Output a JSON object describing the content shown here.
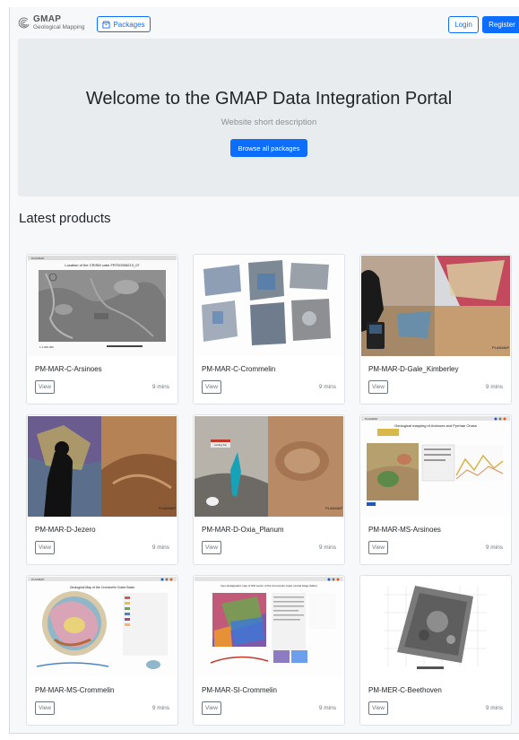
{
  "brand": {
    "title": "GMAP",
    "subtitle": "Geological Mapping"
  },
  "nav": {
    "packages_label": "Packages",
    "login_label": "Login",
    "register_label": "Register"
  },
  "hero": {
    "title": "Welcome to the GMAP Data Integration Portal",
    "subtitle": "Website short description",
    "button_label": "Browse all packages"
  },
  "section": {
    "title": "Latest products"
  },
  "products": [
    {
      "name": "PM-MAR-C-Arsinoes",
      "view_label": "View",
      "time": "9 mins"
    },
    {
      "name": "PM-MAR-C-Crommelin",
      "view_label": "View",
      "time": "9 mins"
    },
    {
      "name": "PM-MAR-D-Gale_Kimberley",
      "view_label": "View",
      "time": "9 mins"
    },
    {
      "name": "PM-MAR-D-Jezero",
      "view_label": "View",
      "time": "9 mins"
    },
    {
      "name": "PM-MAR-D-Oxia_Planum",
      "view_label": "View",
      "time": "9 mins"
    },
    {
      "name": "PM-MAR-MS-Arsinoes",
      "view_label": "View",
      "time": "9 mins"
    },
    {
      "name": "PM-MAR-MS-Crommelin",
      "view_label": "View",
      "time": "9 mins"
    },
    {
      "name": "PM-MAR-SI-Crommelin",
      "view_label": "View",
      "time": "9 mins"
    },
    {
      "name": "PM-MER-C-Beethoven",
      "view_label": "View",
      "time": "9 mins"
    }
  ],
  "thumb_text": {
    "t1_heading": "Location of the CRISM cube FRT00008213_07",
    "t1_scale": "1:1.000.000",
    "t5_sign": "Landing Site",
    "t6_heading": "Geological mapping of Arsinoes and Pyrrhae Chaos",
    "t7_heading": "Geological Map of the Crommelin Crater Basin",
    "t8_heading": "Geo-stratigraphic map of NW sector of the Crommelin crater central bulge (Mars)",
    "planmap_label": "PLANMAP"
  },
  "colors": {
    "primary": "#0d6efd",
    "hero_bg": "#e9ecef",
    "muted": "#6c757d"
  }
}
